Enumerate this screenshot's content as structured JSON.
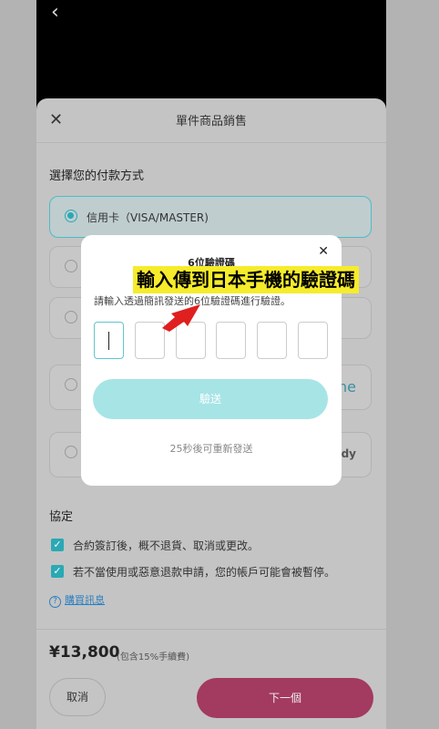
{
  "top_bar": {
    "back_icon": "chevron-left-icon"
  },
  "sheet": {
    "title": "單件商品銷售",
    "close_icon": "close-icon",
    "payment_section_title": "選擇您的付款方式",
    "payment_options": [
      {
        "label": "信用卡（VISA/MASTER)",
        "selected": true
      },
      {
        "label": "",
        "selected": false
      },
      {
        "label": "",
        "selected": false
      },
      {
        "label": "",
        "tail": "ne",
        "selected": false
      },
      {
        "label": "",
        "tail": "idy",
        "selected": false
      }
    ],
    "agreement_title": "協定",
    "agreements": [
      "合約簽訂後，概不退貨、取消或更改。",
      "若不當使用或惡意退款申請，您的帳戶可能會被暫停。"
    ],
    "purchase_info_link": "購買訊息",
    "price": "¥13,800",
    "fee_note": "(包含15%手續費)",
    "cancel_label": "取消",
    "next_label": "下一個"
  },
  "modal": {
    "title": "6位驗證碼",
    "description": "請輸入透過簡訊發送的6位驗證碼進行驗證。",
    "code_digits": [
      "",
      "",
      "",
      "",
      "",
      ""
    ],
    "submit_label": "驗送",
    "resend_text": "25秒後可重新發送",
    "close_icon": "close-icon"
  },
  "annotation": {
    "callout_text": "輸入傳到日本手機的驗證碼",
    "callout_color": "#f6ec2b",
    "arrow_color": "#e01f1f"
  },
  "colors": {
    "accent_teal": "#2aa9b4",
    "next_button": "#a33a60",
    "overlay": "#b3b3b3"
  }
}
